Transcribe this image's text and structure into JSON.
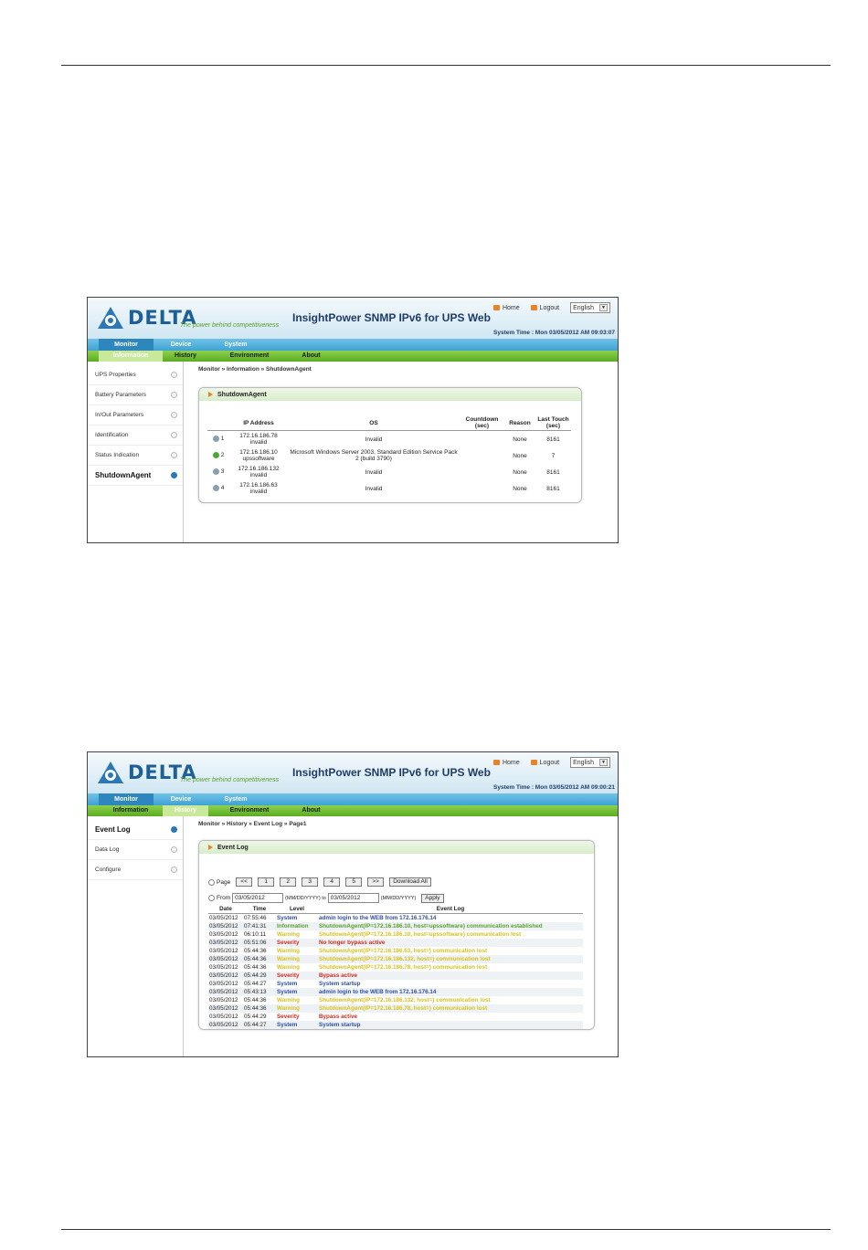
{
  "common": {
    "logo_text": "DELTA",
    "tagline": "The power behind competitiveness",
    "app_title": "InsightPower SNMP IPv6 for UPS Web",
    "home": "Home",
    "logout": "Logout",
    "language": "English",
    "nav_top": [
      "Monitor",
      "Device",
      "System"
    ],
    "nav_sub": [
      "Information",
      "History",
      "Environment",
      "About"
    ]
  },
  "screen1": {
    "system_time": "System Time : Mon 03/05/2012 AM 09:03:07",
    "sidebar": [
      "UPS Properties",
      "Battery Parameters",
      "In/Out Parameters",
      "Identification",
      "Status Indication",
      "ShutdownAgent"
    ],
    "breadcrumb": "Monitor » Information » ShutdownAgent",
    "panel_title": "ShutdownAgent",
    "columns": [
      "IP Address",
      "OS",
      "Countdown (sec)",
      "Reason",
      "Last Touch (sec)"
    ],
    "rows": [
      {
        "no": "1",
        "ip": "172.16.186.78",
        "host": "invalid",
        "os": "Invalid",
        "countdown": "",
        "reason": "None",
        "last": "8161",
        "status": "off"
      },
      {
        "no": "2",
        "ip": "172.16.186.10",
        "host": "upssoftware",
        "os": "Microsoft Windows Server 2003, Standard Edition Service Pack 2 (build 3790)",
        "countdown": "",
        "reason": "None",
        "last": "7",
        "status": "on"
      },
      {
        "no": "3",
        "ip": "172.16.186.132",
        "host": "invalid",
        "os": "Invalid",
        "countdown": "",
        "reason": "None",
        "last": "8161",
        "status": "off"
      },
      {
        "no": "4",
        "ip": "172.16.186.63",
        "host": "invalid",
        "os": "Invalid",
        "countdown": "",
        "reason": "None",
        "last": "8161",
        "status": "off"
      }
    ]
  },
  "screen2": {
    "system_time": "System Time : Mon 03/05/2012 AM 09:00:21",
    "sidebar": [
      "Event Log",
      "Data Log",
      "Configure"
    ],
    "breadcrumb": "Monitor » History » Event Log » Page1",
    "panel_title": "Event Log",
    "page_label": "Page",
    "page_buttons": [
      "<<",
      "1",
      "2",
      "3",
      "4",
      "5",
      ">>"
    ],
    "download_all": "Download All",
    "from_label": "From",
    "from_value": "03/05/2012",
    "from_hint": "(MM/DD/YYYY) to",
    "to_value": "03/05/2012",
    "to_hint": "(MM/DD/YYYY)",
    "apply": "Apply",
    "columns": [
      "Date",
      "Time",
      "Level",
      "Event Log"
    ],
    "events": [
      {
        "date": "03/05/2012",
        "time": "07:55:46",
        "level": "System",
        "text": "admin login to the WEB from 172.16.176.14"
      },
      {
        "date": "03/05/2012",
        "time": "07:41:31",
        "level": "Information",
        "text": "ShutdownAgent(IP=172.16.186.10, host=upssoftware) communication established"
      },
      {
        "date": "03/05/2012",
        "time": "06:10:11",
        "level": "Warning",
        "text": "ShutdownAgent(IP=172.16.186.10, host=upssoftware) communication lost"
      },
      {
        "date": "03/05/2012",
        "time": "05:51:06",
        "level": "Severity",
        "text": "No longer bypass active"
      },
      {
        "date": "03/05/2012",
        "time": "05:44:36",
        "level": "Warning",
        "text": "ShutdownAgent(IP=172.16.186.63, host=) communication lost"
      },
      {
        "date": "03/05/2012",
        "time": "05:44:36",
        "level": "Warning",
        "text": "ShutdownAgent(IP=172.16.186.132, host=) communication lost"
      },
      {
        "date": "03/05/2012",
        "time": "05:44:36",
        "level": "Warning",
        "text": "ShutdownAgent(IP=172.16.186.78, host=) communication lost"
      },
      {
        "date": "03/05/2012",
        "time": "05:44:29",
        "level": "Severity",
        "text": "Bypass active"
      },
      {
        "date": "03/05/2012",
        "time": "05:44:27",
        "level": "System",
        "text": "System startup"
      },
      {
        "date": "03/05/2012",
        "time": "05:43:13",
        "level": "System",
        "text": "admin login to the WEB from 172.16.176.14"
      },
      {
        "date": "03/05/2012",
        "time": "05:44:36",
        "level": "Warning",
        "text": "ShutdownAgent(IP=172.16.186.132, host=) communication lost"
      },
      {
        "date": "03/05/2012",
        "time": "05:44:36",
        "level": "Warning",
        "text": "ShutdownAgent(IP=172.16.186.78, host=) communication lost"
      },
      {
        "date": "03/05/2012",
        "time": "05:44:29",
        "level": "Severity",
        "text": "Bypass active"
      },
      {
        "date": "03/05/2012",
        "time": "05:44:27",
        "level": "System",
        "text": "System startup"
      }
    ]
  }
}
